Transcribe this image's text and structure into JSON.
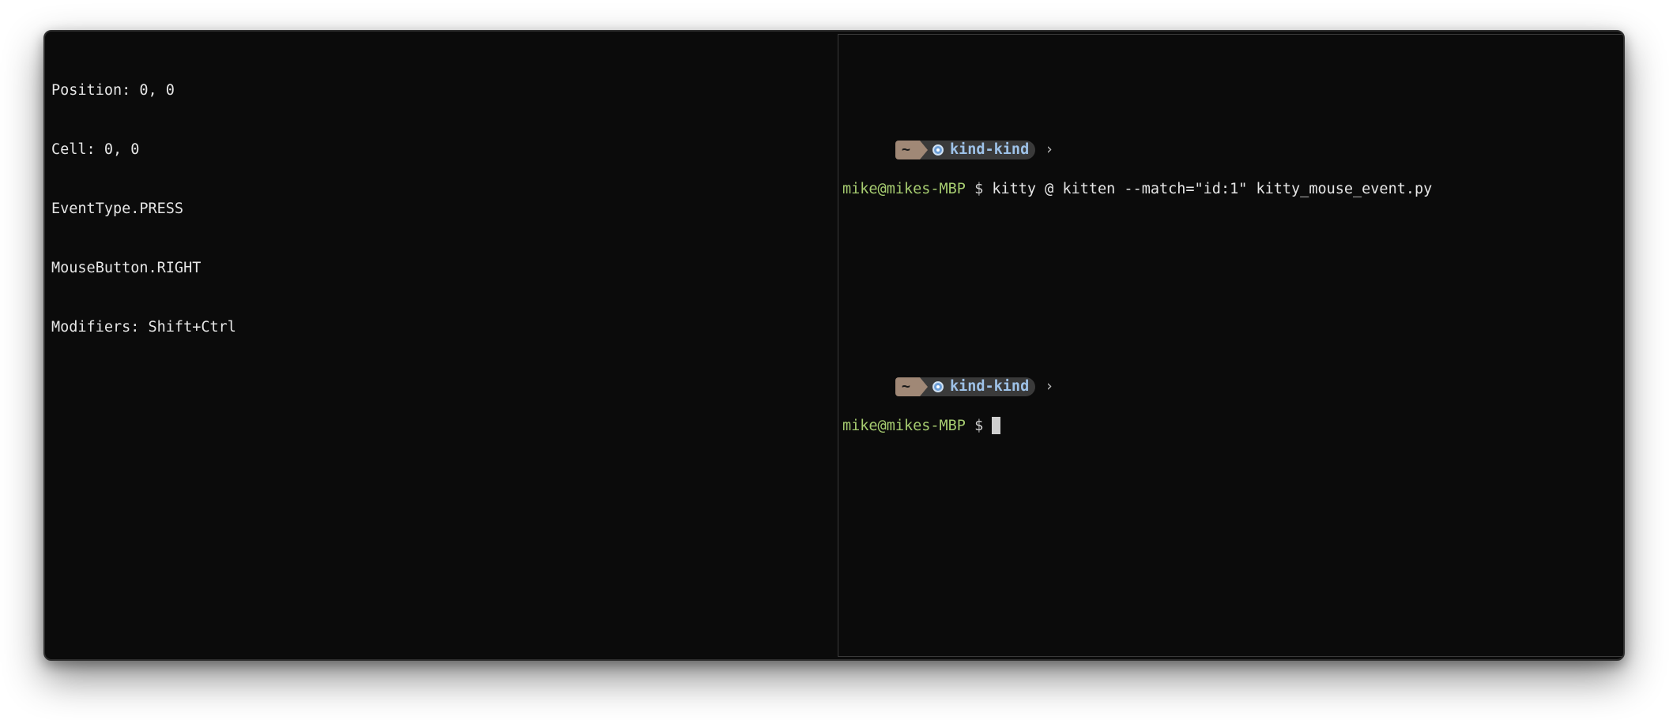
{
  "left_pane": {
    "lines": [
      "Position: 0, 0",
      "Cell: 0, 0",
      "EventType.PRESS",
      "MouseButton.RIGHT",
      "Modifiers: Shift+Ctrl"
    ]
  },
  "right_pane": {
    "prompt1": {
      "home": "~",
      "context": "kind-kind",
      "chevron": "›",
      "userhost": "mike@mikes-MBP",
      "symbol": "$",
      "command": "kitty @ kitten --match=\"id:1\" kitty_mouse_event.py"
    },
    "prompt2": {
      "home": "~",
      "context": "kind-kind",
      "chevron": "›",
      "userhost": "mike@mikes-MBP",
      "symbol": "$",
      "command": ""
    },
    "context_icon": "kubernetes-icon"
  },
  "colors": {
    "background": "#0b0b0b",
    "text": "#e6e6e6",
    "userhost": "#a6cc70",
    "home_segment": "#a08876",
    "context_segment": "#3a3a3a",
    "context_text": "#9ec2e8"
  }
}
